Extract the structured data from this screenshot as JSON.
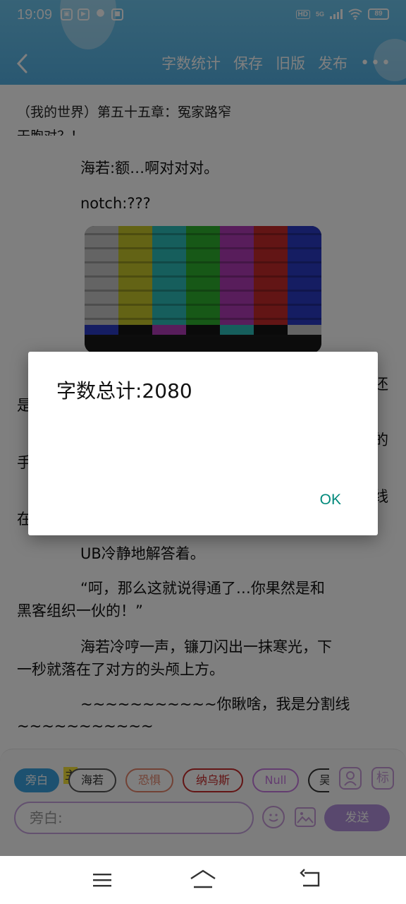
{
  "status_bar": {
    "time": "19:09",
    "hd": "HD",
    "network": "5G",
    "battery": "89"
  },
  "app_bar": {
    "actions": [
      "字数统计",
      "保存",
      "旧版",
      "发布"
    ],
    "more": "•••"
  },
  "document": {
    "chapter_title": "（我的世界）第五十五章：冤家路窄",
    "partial_line": "干胞对？！",
    "paragraphs": [
      "海若:额…啊对对对。",
      "notch:???",
      "还",
      "是",
      "的",
      "手",
      "线",
      "在",
      "UB冷静地解答着。",
      "“呵，那么这就说得通了…你果然是和",
      "黑客组织一伙的！”",
      "海若冷哼一声，镰刀闪出一抹寒光，下",
      "一秒就落在了对方的头颅上方。",
      "~~~~~~~~~~~你瞅啥，我是分割线",
      "~~~~~~~~~~~"
    ]
  },
  "roles": {
    "chips": [
      "旁白",
      "海若",
      "恐惧",
      "纳乌斯",
      "Null",
      "吴"
    ],
    "marker": "主",
    "chip_colors": [
      "#3aa3e0",
      "#555555",
      "#e5846a",
      "#c62a2a",
      "#c77ae0",
      "#333333"
    ],
    "side_icons": [
      "person-icon",
      "标"
    ]
  },
  "composer": {
    "placeholder": "旁白:",
    "send_label": "发送"
  },
  "dialog": {
    "message": "字数总计:2080",
    "ok_label": "OK"
  }
}
